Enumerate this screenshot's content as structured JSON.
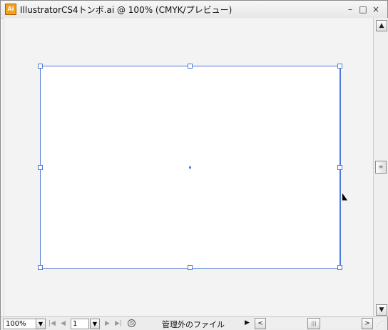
{
  "window": {
    "title": "IllustratorCS4トンボ.ai @ 100% (CMYK/プレビュー)",
    "icon_label": "Ai",
    "buttons": {
      "minimize": "–",
      "maximize": "□",
      "close": "×"
    }
  },
  "statusbar": {
    "zoom": "100%",
    "page": "1",
    "status_text": "管理外のファイル",
    "icons": {
      "dropdown": "▼",
      "first": "|◀",
      "prev": "◀",
      "next": "▶",
      "last": "▶|",
      "status_arrow": "▶",
      "scroll_left": "<",
      "scroll_right": ">",
      "grip": "⋰"
    }
  },
  "scrollbar": {
    "up": "▲",
    "down": "▼",
    "thumb_grip": "≡"
  },
  "colors": {
    "selection": "#4f79d6",
    "app_icon": "#f7a11a"
  }
}
